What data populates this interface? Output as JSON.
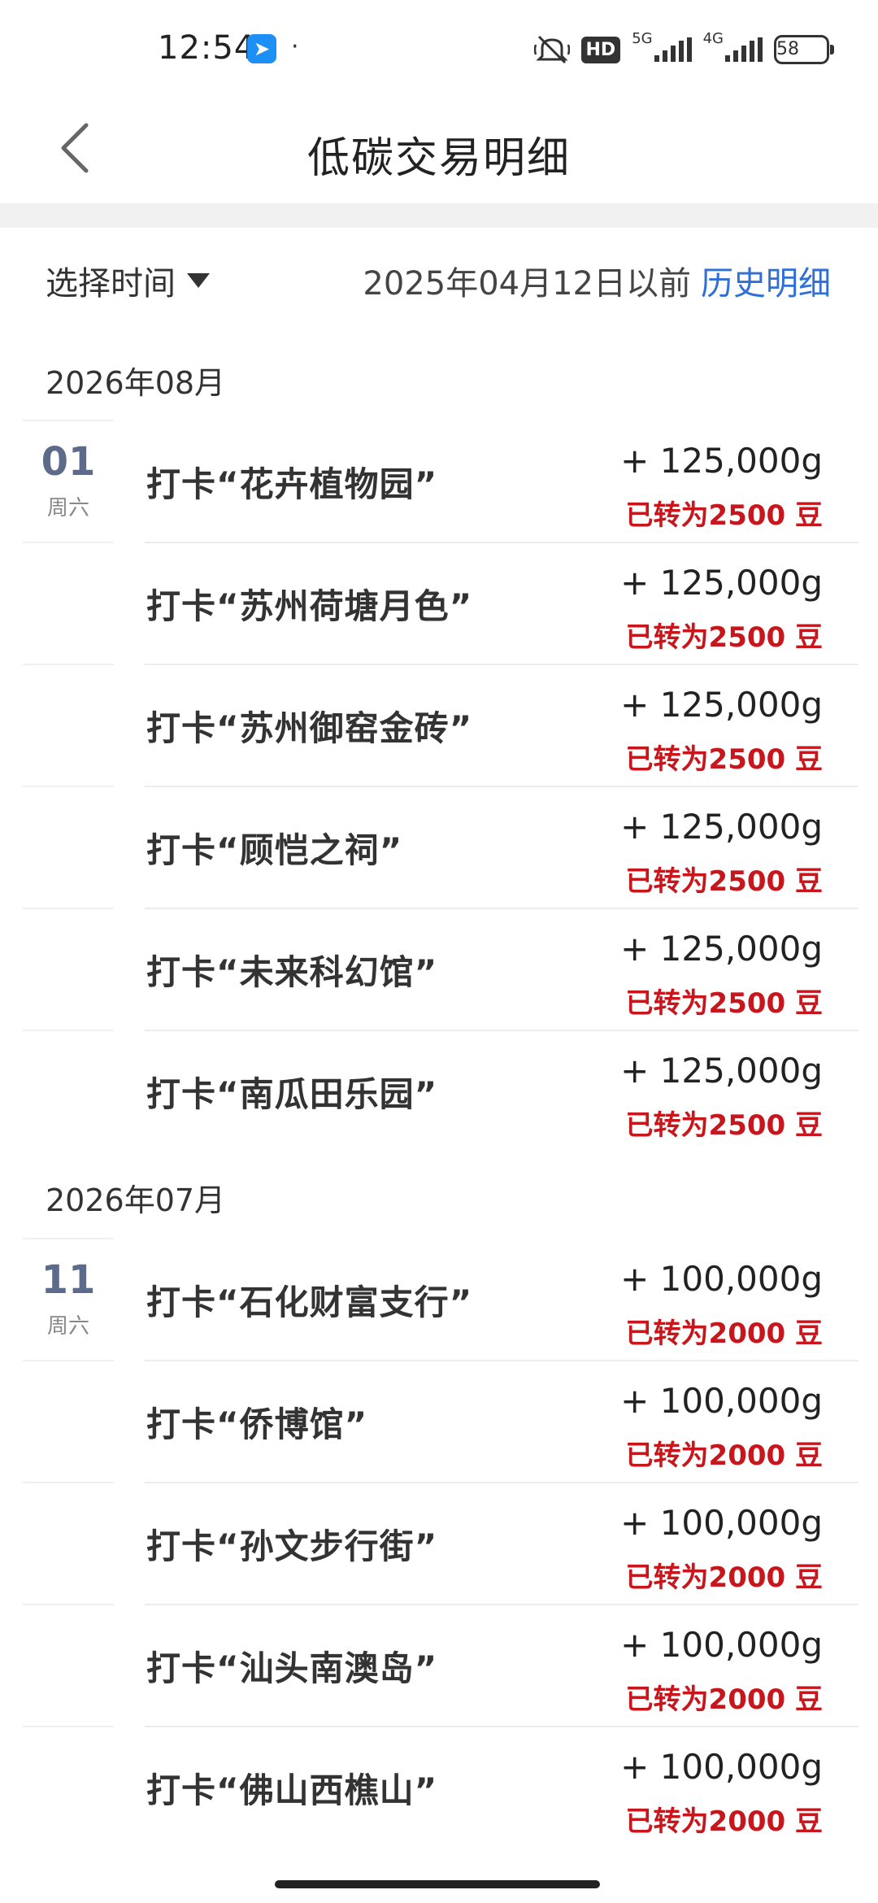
{
  "status_bar": {
    "time": "12:54",
    "app_notification": "➤",
    "dot": "·",
    "hd_label": "HD",
    "net1": "5G",
    "net2": "4G",
    "battery": "58"
  },
  "header": {
    "title": "低碳交易明细"
  },
  "filter": {
    "select_label": "选择时间",
    "date_text": "2025年04月12日以前",
    "history_label": "历史明细"
  },
  "groups": [
    {
      "month": "2026年08月",
      "day": "01",
      "weekday": "周六",
      "items": [
        {
          "title": "打卡“花卉植物园”",
          "amount": "+ 125,000g",
          "converted": "已转为2500 豆"
        },
        {
          "title": "打卡“苏州荷塘月色”",
          "amount": "+ 125,000g",
          "converted": "已转为2500 豆"
        },
        {
          "title": "打卡“苏州御窑金砖”",
          "amount": "+ 125,000g",
          "converted": "已转为2500 豆"
        },
        {
          "title": "打卡“顾恺之祠”",
          "amount": "+ 125,000g",
          "converted": "已转为2500 豆"
        },
        {
          "title": "打卡“未来科幻馆”",
          "amount": "+ 125,000g",
          "converted": "已转为2500 豆"
        },
        {
          "title": "打卡“南瓜田乐园”",
          "amount": "+ 125,000g",
          "converted": "已转为2500 豆"
        }
      ]
    },
    {
      "month": "2026年07月",
      "day": "11",
      "weekday": "周六",
      "items": [
        {
          "title": "打卡“石化财富支行”",
          "amount": "+ 100,000g",
          "converted": "已转为2000 豆"
        },
        {
          "title": "打卡“侨博馆”",
          "amount": "+ 100,000g",
          "converted": "已转为2000 豆"
        },
        {
          "title": "打卡“孙文步行街”",
          "amount": "+ 100,000g",
          "converted": "已转为2000 豆"
        },
        {
          "title": "打卡“汕头南澳岛”",
          "amount": "+ 100,000g",
          "converted": "已转为2000 豆"
        },
        {
          "title": "打卡“佛山西樵山”",
          "amount": "+ 100,000g",
          "converted": "已转为2000 豆"
        }
      ]
    }
  ],
  "colors": {
    "accent_link": "#2f6fd6",
    "converted_red": "#c8161d",
    "day_number": "#5c6b8a"
  }
}
